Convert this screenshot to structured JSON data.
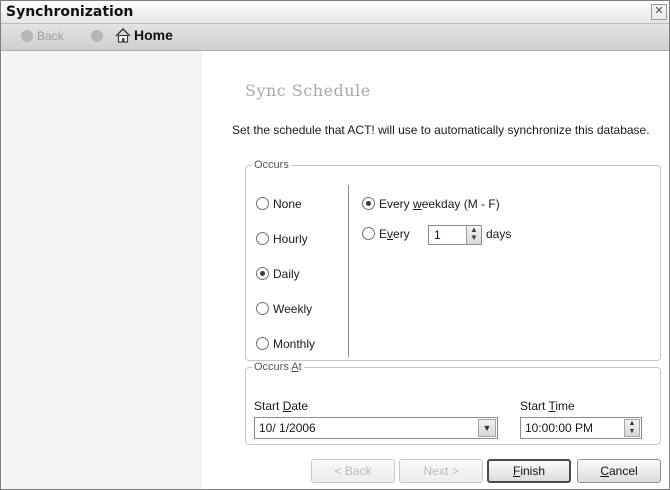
{
  "window": {
    "title": "Synchronization",
    "close_glyph": "✕"
  },
  "toolbar": {
    "back_label": "Back",
    "home_label": "Home"
  },
  "page": {
    "heading": "Sync Schedule",
    "instruction": "Set the schedule that ACT! will use to automatically synchronize this database."
  },
  "occurs": {
    "legend": "Occurs",
    "options": [
      {
        "label": "None",
        "selected": false
      },
      {
        "label": "Hourly",
        "selected": false
      },
      {
        "label": "Daily",
        "selected": true
      },
      {
        "label": "Weekly",
        "selected": false
      },
      {
        "label": "Monthly",
        "selected": false
      }
    ],
    "daily": {
      "weekday_pre": "Every ",
      "weekday_u": "w",
      "weekday_post": "eekday (M - F)",
      "weekday_selected": true,
      "every_pre": "E",
      "every_u": "v",
      "every_post": "ery",
      "every_selected": false,
      "every_value": "1",
      "days_label": "days"
    }
  },
  "occurs_at": {
    "legend_pre": "Occurs ",
    "legend_u": "A",
    "legend_post": "t",
    "start_date_pre": "Start ",
    "start_date_u": "D",
    "start_date_post": "ate",
    "start_date_value": "10/ 1/2006",
    "start_time_pre": "Start ",
    "start_time_u": "T",
    "start_time_post": "ime",
    "start_time_value": "10:00:00 PM"
  },
  "buttons": {
    "back": "< Back",
    "next": "Next >",
    "finish_u": "F",
    "finish_rest": "inish",
    "cancel_u": "C",
    "cancel_rest": "ancel"
  },
  "icons": {
    "back": "back-arrow-icon",
    "forward": "forward-arrow-icon",
    "home": "home-icon",
    "close": "close-icon",
    "dropdown": "chevron-down-icon",
    "spinner": "spinner-icon"
  }
}
